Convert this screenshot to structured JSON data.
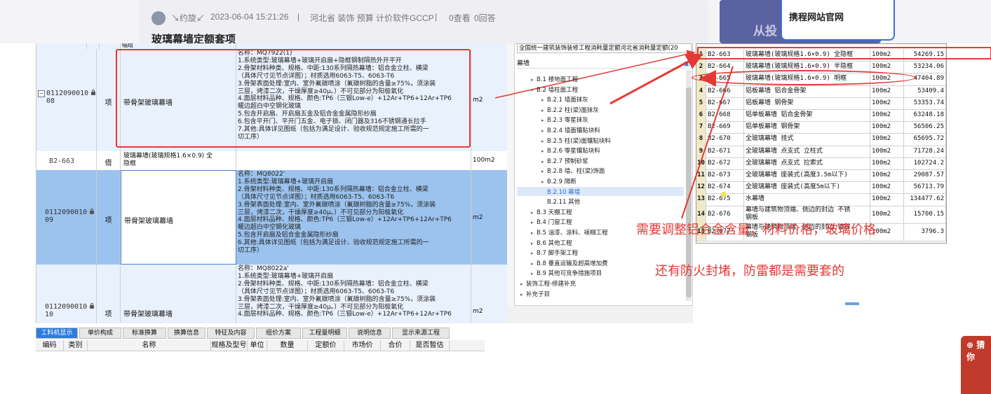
{
  "post": {
    "author": "↘约旋↙",
    "date": "2023-06-04 15:21:26",
    "sep1": "|",
    "region_tags": "河北省 装饰 预算 计价软件GCCP",
    "sep2": "|",
    "views": "0查看",
    "answers": "0回答",
    "title": "玻璃幕墙定额套项"
  },
  "ad": {
    "text": "从投"
  },
  "popup": {
    "text": "携程网站官网"
  },
  "grid": {
    "rows": [
      {
        "code": "0112090010\n08",
        "type": "项",
        "name": "带骨架玻璃幕墙",
        "unit": "m2",
        "desc": "名称：MQ7922(1)\n1.系统类型:玻璃幕墙+玻璃开启扇+隐框钢制隔热外开平开\n2.骨架材料种类、规格、中距:130系列隔热幕墙：铝合金立柱、横梁\n（具体尺寸见节点详图）；材质选用6063-T5、6063-T6\n3.骨架表面处理:室内、室外氟碳喷涂（氟碳树脂的含量≥75%，须涂装\n三层，烤漆二次，干燥厚度≥40μ。）不可见部分为阳极氧化\n4.面层材料品种、规格、颜色:TP6（三银Low-e）+12Ar+TP6+12Ar+TP6\n暖边超白中空钢化玻璃\n5.包含开启扇、开启扇五金及铝合金金属隐形纱扇\n6.包含平开门、平开门五金、电子锁、闭门器及316不锈钢通长拉手\n7.其他:具体详见图纸（包括为满足设计、验收规范规定施工所需的一\n切工序）"
      },
      {
        "code": "B2-663",
        "type": "借",
        "name": "玻璃幕墙(玻璃规格1.6×0.9) 全\n隐框",
        "unit": "100m2",
        "desc": ""
      },
      {
        "code": "0112090010\n09",
        "type": "项",
        "name": "带骨架玻璃幕墙",
        "unit": "m2",
        "desc": "名称：MQ8022'\n1.系统类型:玻璃幕墙+玻璃开启扇\n2.骨架材料种类、规格、中距:130系列隔热幕墙：铝合金立柱、横梁\n（具体尺寸见节点详图）；材质选用6063-T5、6063-T6\n3.骨架表面处理:室内、室外氟碳喷涂（氟碳树脂的含量≥75%，须涂装\n三层，烤漆二次，干燥厚度≥40μ。）不可见部分为阳极氧化\n4.面层材料品种、规格、颜色:TP6（三银Low-e）+12Ar+TP6+12Ar+TP6\n暖边超白中空钢化玻璃\n5.包含开启扇及铝合金金属隐形纱扇\n6.其他:具体详见图纸（包括为满足设计、验收规范规定施工所需的一\n切工序）"
      },
      {
        "code": "0112090010\n10",
        "type": "项",
        "name": "带骨架玻璃幕墙",
        "unit": "m2",
        "desc": "名称：MQ8022a'\n1.系统类型:玻璃幕墙+玻璃开启扇\n2.骨架材料种类、规格、中距:130系列隔热幕墙：铝合金立柱、横梁\n（具体尺寸见节点详图）；材质选用6063-T5、6063-T6\n3.骨架表面处理:室内、室外氟碳喷涂（氟碳树脂的含量≥75%，须涂装\n三层，烤漆二次，干燥厚度≥40μ。）不可见部分为阳极氧化\n4.面层材料品种、规格、颜色:TP6（三银Low-e）+12Ar+TP6+12Ar+TP6"
      }
    ],
    "top_partial_name": "幅组"
  },
  "tree": {
    "select_value": "全国统一建筑装饰装修工程消耗量定额河北省消耗量定额(20",
    "search_value": "幕墙",
    "items": [
      {
        "label": "B.1 楼地面工程",
        "level": 1,
        "arrow": "▸"
      },
      {
        "label": "B.2 墙柱面工程",
        "level": 1,
        "arrow": "▾"
      },
      {
        "label": "B.2.1 墙面抹灰",
        "level": 2,
        "arrow": "▸"
      },
      {
        "label": "B.2.2 柱(梁)面抹灰",
        "level": 2,
        "arrow": "▸"
      },
      {
        "label": "B.2.3 零星抹灰",
        "level": 2,
        "arrow": "▸"
      },
      {
        "label": "B.2.4 墙面镶贴块料",
        "level": 2,
        "arrow": "▸"
      },
      {
        "label": "B.2.5 柱(梁)面镶贴块料",
        "level": 2,
        "arrow": "▸"
      },
      {
        "label": "B.2.6 零星镶贴块料",
        "level": 2,
        "arrow": "▸"
      },
      {
        "label": "B.2.7 预制砂浆",
        "level": 2,
        "arrow": "▸"
      },
      {
        "label": "B.2.8 墙、柱(梁)饰面",
        "level": 2,
        "arrow": "▸"
      },
      {
        "label": "B.2.9 隔断",
        "level": 2,
        "arrow": "▸"
      },
      {
        "label": "B.2.10 幕墙",
        "level": 2,
        "arrow": "",
        "selected": true
      },
      {
        "label": "B.2.11 其他",
        "level": 2,
        "arrow": ""
      },
      {
        "label": "B.3 天棚工程",
        "level": 1,
        "arrow": "▸"
      },
      {
        "label": "B.4 门窗工程",
        "level": 1,
        "arrow": "▸"
      },
      {
        "label": "B.5 油漆、涂料、裱糊工程",
        "level": 1,
        "arrow": "▸"
      },
      {
        "label": "B.6 其他工程",
        "level": 1,
        "arrow": "▸"
      },
      {
        "label": "B.7 脚手架工程",
        "level": 1,
        "arrow": "▸"
      },
      {
        "label": "B.8 垂直运输及超高增加费",
        "level": 1,
        "arrow": "▸"
      },
      {
        "label": "B.9 其他可竞争措施项目",
        "level": 1,
        "arrow": "▸"
      },
      {
        "label": "装饰工程-修建补充",
        "level": 0,
        "arrow": "▸"
      },
      {
        "label": "补充子目",
        "level": 0,
        "arrow": "▸"
      }
    ]
  },
  "quota": {
    "rows": [
      {
        "n": "1",
        "code": "B2-663",
        "name": "玻璃幕墙(玻璃规格1.6×0.9) 全隐框",
        "unit": "100m2",
        "price": "54269.15"
      },
      {
        "n": "2",
        "code": "B2-664",
        "name": "玻璃幕墙(玻璃规格1.6×0.9) 半隐框",
        "unit": "100m2",
        "price": "53234.06"
      },
      {
        "n": "3",
        "code": "B2-665",
        "name": "玻璃幕墙(玻璃规格1.6×0.9) 明框",
        "unit": "100m2",
        "price": "47404.89"
      },
      {
        "n": "4",
        "code": "B2-666",
        "name": "铝板幕墙 铝合金骨架",
        "unit": "100m2",
        "price": "53409.4"
      },
      {
        "n": "5",
        "code": "B2-667",
        "name": "铝板幕墙 钢骨架",
        "unit": "100m2",
        "price": "53353.74"
      },
      {
        "n": "6",
        "code": "B2-668",
        "name": "铝单板幕墙 铝合金骨架",
        "unit": "100m2",
        "price": "63248.18"
      },
      {
        "n": "7",
        "code": "B2-669",
        "name": "铝单板幕墙 钢骨架",
        "unit": "100m2",
        "price": "56506.25"
      },
      {
        "n": "8",
        "code": "B2-670",
        "name": "全玻璃幕墙 挂式",
        "unit": "100m2",
        "price": "65695.72"
      },
      {
        "n": "9",
        "code": "B2-671",
        "name": "全玻璃幕墙 点支式 立柱式",
        "unit": "100m2",
        "price": "71728.24"
      },
      {
        "n": "10",
        "code": "B2-672",
        "name": "全玻璃幕墙 点支式 拉索式",
        "unit": "100m2",
        "price": "102724.2"
      },
      {
        "n": "11",
        "code": "B2-673",
        "name": "全玻璃幕墙 座装式(高度3.5m以下)",
        "unit": "100m2",
        "price": "29087.57"
      },
      {
        "n": "12",
        "code": "B2-674",
        "name": "全玻璃幕墙 座装式(高度5m以下)",
        "unit": "100m2",
        "price": "56713.79"
      },
      {
        "n": "13",
        "code": "B2-675",
        "name": "水幕墙",
        "unit": "100m2",
        "price": "134477.62"
      },
      {
        "n": "14",
        "code": "B2-676",
        "name": "幕墙与建筑物顶端、侧边的封边 不锈\n钢板",
        "unit": "100m2",
        "price": "15700.15"
      },
      {
        "n": "15",
        "code": "B2-677",
        "name": "幕墙与建筑物顶端、侧边的封边 镀锌\n钢板",
        "unit": "100m2",
        "price": "3796.3"
      }
    ]
  },
  "bottom": {
    "tabs": [
      "工料机显示",
      "单价构成",
      "标准换算",
      "换算信息",
      "特征及内容",
      "组价方案",
      "工程量明细",
      "说明信息",
      "显示来源工程"
    ],
    "headers": [
      "编码",
      "类别",
      "名称",
      "规格及型号",
      "单位",
      "数量",
      "定额价",
      "市场价",
      "合价",
      "是否暂估"
    ]
  },
  "annotations": {
    "line1": "需要调整铝合金含量，材料价格，玻璃价格",
    "line2": "还有防火封堵，防雷都是需要套的"
  },
  "badge": {
    "text": "猜你"
  },
  "colors": {
    "annotation": "#e53935",
    "selected_row": "#9cc3ee",
    "row_bg": "#e9f1fc"
  }
}
